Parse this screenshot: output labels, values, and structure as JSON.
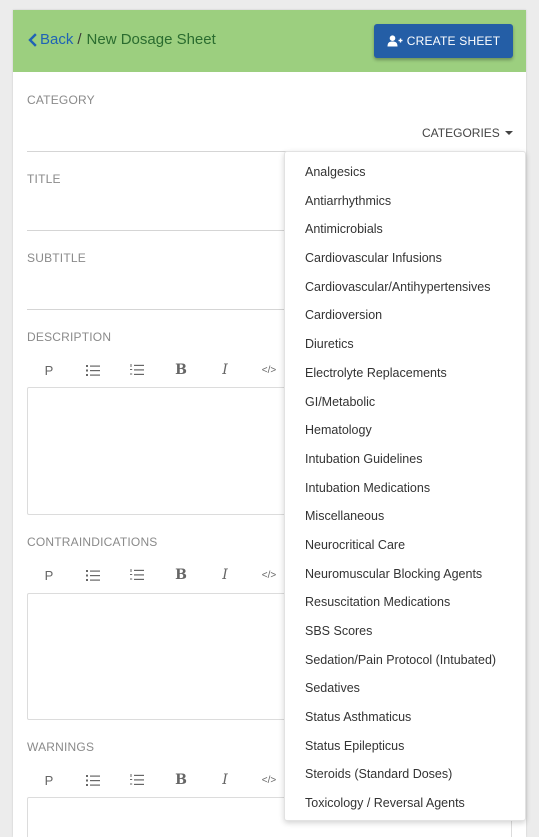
{
  "header": {
    "back_label": "Back",
    "separator": "/",
    "current_page": "New Dosage Sheet",
    "create_button_label": "CREATE SHEET"
  },
  "form": {
    "category_label": "CATEGORY",
    "category_toggle_label": "CATEGORIES",
    "title_label": "TITLE",
    "subtitle_label": "SUBTITLE",
    "description_label": "DESCRIPTION",
    "contraindications_label": "CONTRAINDICATIONS",
    "warnings_label": "WARNINGS"
  },
  "toolbar": {
    "paragraph": "P",
    "bold": "B",
    "italic": "I",
    "code": "</>"
  },
  "categories": [
    "Analgesics",
    "Antiarrhythmics",
    "Antimicrobials",
    "Cardiovascular Infusions",
    "Cardiovascular/Antihypertensives",
    "Cardioversion",
    "Diuretics",
    "Electrolyte Replacements",
    "GI/Metabolic",
    "Hematology",
    "Intubation Guidelines",
    "Intubation Medications",
    "Miscellaneous",
    "Neurocritical Care",
    "Neuromuscular Blocking Agents",
    "Resuscitation Medications",
    "SBS Scores",
    "Sedation/Pain Protocol (Intubated)",
    "Sedatives",
    "Status Asthmaticus",
    "Status Epilepticus",
    "Steroids (Standard Doses)",
    "Toxicology / Reversal Agents"
  ],
  "colors": {
    "header_bg": "#9ccf7f",
    "primary_button": "#245ea6",
    "back_link": "#1f63b5",
    "current_page_text": "#2a6c2f"
  }
}
